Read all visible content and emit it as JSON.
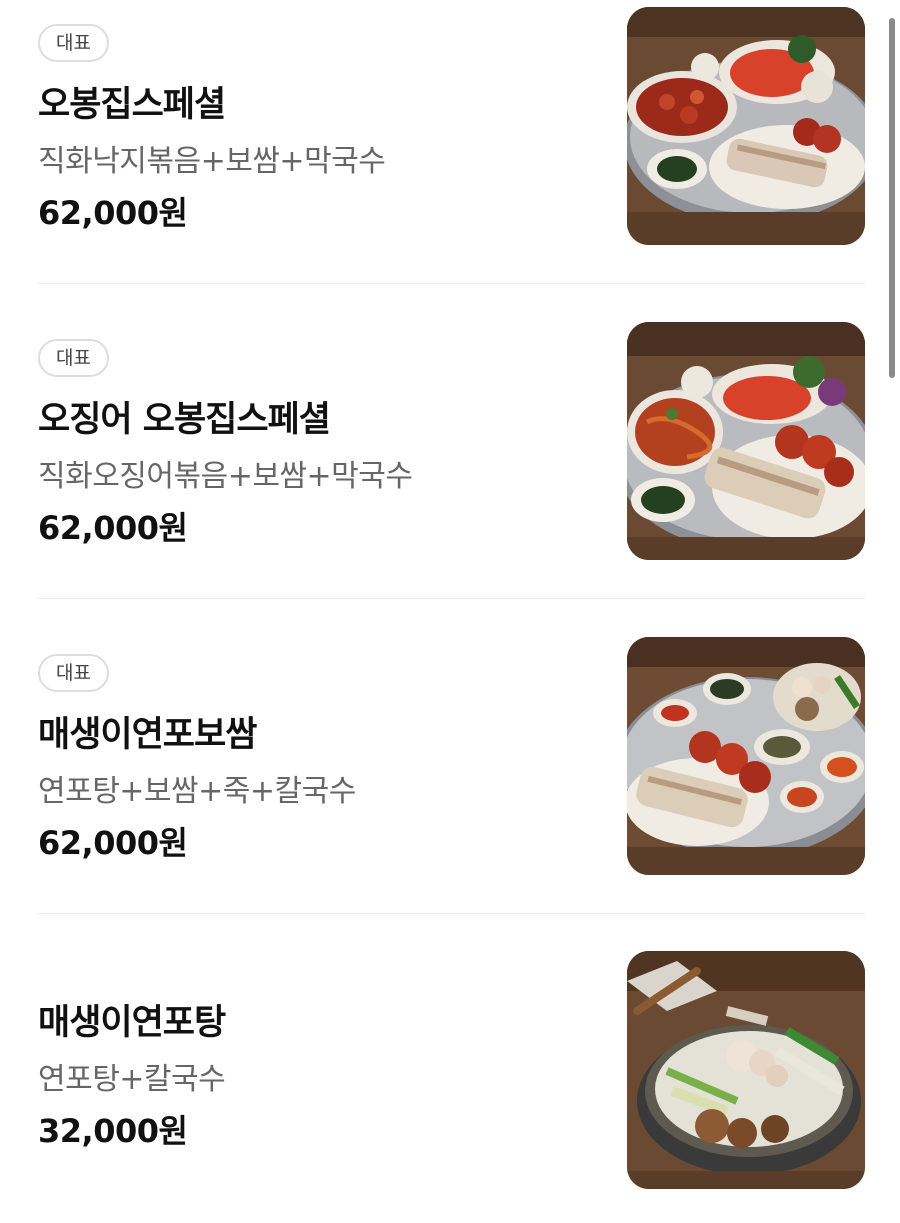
{
  "menu": {
    "items": [
      {
        "badge": "대표",
        "name": "오봉집스페셜",
        "description": "직화낙지볶음+보쌈+막국수",
        "price": "62,000원",
        "image": "food-photo-platter-nakji-bossam"
      },
      {
        "badge": "대표",
        "name": "오징어 오봉집스페셜",
        "description": "직화오징어볶음+보쌈+막국수",
        "price": "62,000원",
        "image": "food-photo-platter-squid-bossam"
      },
      {
        "badge": "대표",
        "name": "매생이연포보쌈",
        "description": "연포탕+보쌈+죽+칼국수",
        "price": "62,000원",
        "image": "food-photo-platter-yeonpo-bossam"
      },
      {
        "name": "매생이연포탕",
        "description": "연포탕+칼국수",
        "price": "32,000원",
        "image": "food-photo-yeonpo-hotpot"
      }
    ]
  },
  "colors": {
    "background": "#ffffff",
    "title_text": "#111111",
    "desc_text": "#666666",
    "badge_border": "#dddddd",
    "divider": "#ececec"
  }
}
